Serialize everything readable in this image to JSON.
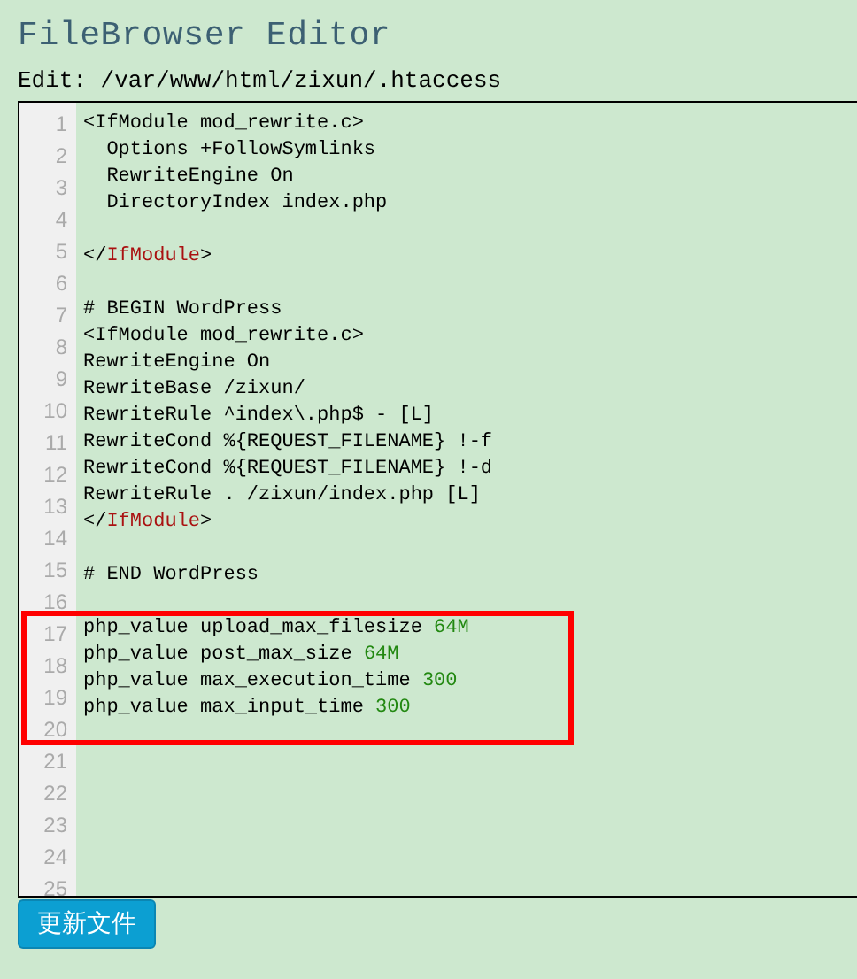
{
  "title": "FileBrowser Editor",
  "edit_label": "Edit: /var/www/html/zixun/.htaccess",
  "editor": {
    "line_numbers": [
      "1",
      "2",
      "3",
      "4",
      "5",
      "6",
      "7",
      "8",
      "9",
      "10",
      "11",
      "12",
      "13",
      "14",
      "15",
      "16",
      "17",
      "18",
      "19",
      "20",
      "21",
      "22",
      "23",
      "24",
      "25"
    ],
    "lines": [
      {
        "kind": "code",
        "segments": [
          {
            "kind": "plain",
            "text": "<IfModule mod_rewrite.c>"
          }
        ]
      },
      {
        "kind": "code",
        "segments": [
          {
            "kind": "plain",
            "text": "  Options +FollowSymlinks"
          }
        ]
      },
      {
        "kind": "code",
        "segments": [
          {
            "kind": "plain",
            "text": "  RewriteEngine On"
          }
        ]
      },
      {
        "kind": "code",
        "segments": [
          {
            "kind": "plain",
            "text": "  DirectoryIndex index.php"
          }
        ]
      },
      {
        "kind": "blank"
      },
      {
        "kind": "code",
        "segments": [
          {
            "kind": "plain",
            "text": "</"
          },
          {
            "kind": "tag",
            "text": "IfModule"
          },
          {
            "kind": "plain",
            "text": ">"
          }
        ]
      },
      {
        "kind": "blank"
      },
      {
        "kind": "code",
        "segments": [
          {
            "kind": "plain",
            "text": "# BEGIN WordPress"
          }
        ]
      },
      {
        "kind": "code",
        "segments": [
          {
            "kind": "plain",
            "text": "<IfModule mod_rewrite.c>"
          }
        ]
      },
      {
        "kind": "code",
        "segments": [
          {
            "kind": "plain",
            "text": "RewriteEngine On"
          }
        ]
      },
      {
        "kind": "code",
        "segments": [
          {
            "kind": "plain",
            "text": "RewriteBase /zixun/"
          }
        ]
      },
      {
        "kind": "code",
        "segments": [
          {
            "kind": "plain",
            "text": "RewriteRule ^index\\.php$ - [L]"
          }
        ]
      },
      {
        "kind": "code",
        "segments": [
          {
            "kind": "plain",
            "text": "RewriteCond %{REQUEST_FILENAME} !-f"
          }
        ]
      },
      {
        "kind": "code",
        "segments": [
          {
            "kind": "plain",
            "text": "RewriteCond %{REQUEST_FILENAME} !-d"
          }
        ]
      },
      {
        "kind": "code",
        "segments": [
          {
            "kind": "plain",
            "text": "RewriteRule . /zixun/index.php [L]"
          }
        ]
      },
      {
        "kind": "code",
        "segments": [
          {
            "kind": "plain",
            "text": "</"
          },
          {
            "kind": "tag",
            "text": "IfModule"
          },
          {
            "kind": "plain",
            "text": ">"
          }
        ]
      },
      {
        "kind": "blank"
      },
      {
        "kind": "code",
        "segments": [
          {
            "kind": "plain",
            "text": "# END WordPress"
          }
        ]
      },
      {
        "kind": "blank"
      }
    ],
    "highlight_box": {
      "lines": [
        {
          "kind": "code",
          "segments": [
            {
              "kind": "plain",
              "text": "php_value upload_max_filesize "
            },
            {
              "kind": "number",
              "text": "64M"
            }
          ]
        },
        {
          "kind": "code",
          "segments": [
            {
              "kind": "plain",
              "text": "php_value post_max_size "
            },
            {
              "kind": "number",
              "text": "64M"
            }
          ]
        },
        {
          "kind": "code",
          "segments": [
            {
              "kind": "plain",
              "text": "php_value max_execution_time "
            },
            {
              "kind": "number",
              "text": "300"
            }
          ]
        },
        {
          "kind": "code",
          "segments": [
            {
              "kind": "plain",
              "text": "php_value max_input_time "
            },
            {
              "kind": "number",
              "text": "300"
            }
          ]
        },
        {
          "kind": "blank"
        }
      ]
    }
  },
  "button": "更新文件"
}
